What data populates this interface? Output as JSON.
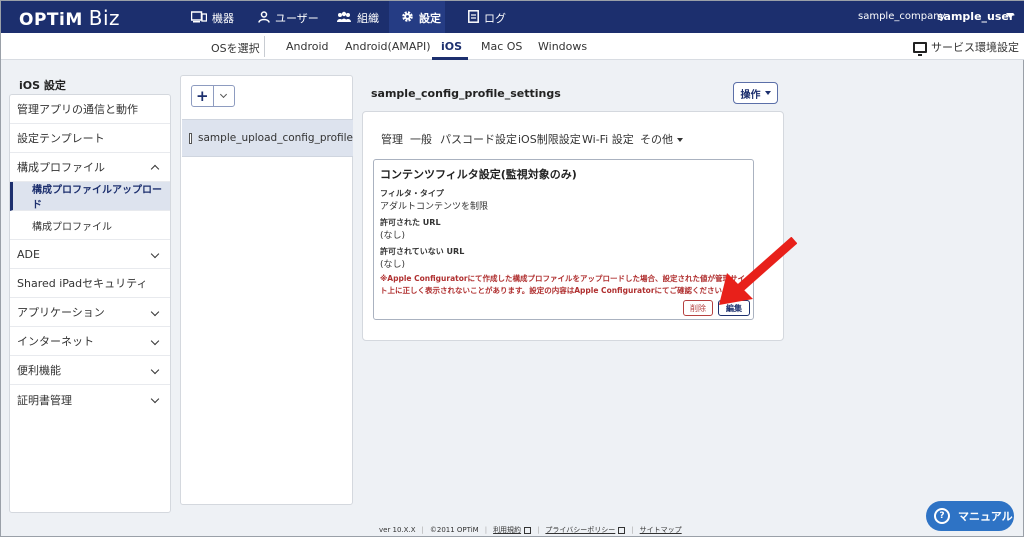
{
  "header": {
    "logo_brand": "OPTiM",
    "logo_product": "Biz",
    "nav": [
      {
        "label": "機器",
        "icon": "devices-icon"
      },
      {
        "label": "ユーザー",
        "icon": "user-icon"
      },
      {
        "label": "組織",
        "icon": "organization-icon"
      },
      {
        "label": "設定",
        "icon": "gear-icon"
      },
      {
        "label": "ログ",
        "icon": "log-icon"
      }
    ],
    "company": "sample_company",
    "user": "sample_user"
  },
  "osbar": {
    "select_label": "OSを選択",
    "tabs": [
      "Android",
      "Android(AMAPI)",
      "iOS",
      "Mac OS",
      "Windows"
    ],
    "active_tab": "iOS",
    "service_settings": "サービス環境設定"
  },
  "sidebar": {
    "title": "iOS 設定",
    "items": [
      {
        "label": "管理アプリの通信と動作"
      },
      {
        "label": "設定テンプレート"
      },
      {
        "label": "構成プロファイル"
      },
      {
        "label": "構成プロファイルアップロード"
      },
      {
        "label": "構成プロファイル"
      },
      {
        "label": "ADE"
      },
      {
        "label": "Shared iPadセキュリティ"
      },
      {
        "label": "アプリケーション"
      },
      {
        "label": "インターネット"
      },
      {
        "label": "便利機能"
      },
      {
        "label": "証明書管理"
      }
    ]
  },
  "middle": {
    "add_label": "+",
    "profile_name": "sample_upload_config_profile"
  },
  "content": {
    "title": "sample_config_profile_settings",
    "operation_label": "操作",
    "tabs": [
      "管理",
      "一般",
      "パスコード設定",
      "iOS制限設定",
      "Wi-Fi 設定",
      "その他"
    ],
    "box": {
      "title": "コンテンツフィルタ設定(監視対象のみ)",
      "filter_type_label": "フィルタ・タイプ",
      "filter_type_value": "アダルトコンテンツを制限",
      "allowed_label": "許可された URL",
      "allowed_value": "(なし)",
      "disallowed_label": "許可されていない URL",
      "disallowed_value": "(なし)",
      "warning": "※Apple Configuratorにて作成した構成プロファイルをアップロードした場合、設定された値が管理サイト上に正しく表示されないことがあります。設定の内容はApple Configuratorにてご確認ください。",
      "delete_label": "削除",
      "edit_label": "編集"
    }
  },
  "footer": {
    "version": "ver 10.X.X",
    "copyright": "©2011 OPTiM",
    "terms": "利用規約",
    "privacy": "プライバシーポリシー",
    "sitemap": "サイトマップ"
  },
  "manual_label": "マニュアル",
  "colors": {
    "header_bg": "#1c2f6e",
    "accent": "#1c2f6e",
    "danger": "#b03030",
    "arrow": "#e8201a",
    "manual_bg": "#2e73c5"
  }
}
